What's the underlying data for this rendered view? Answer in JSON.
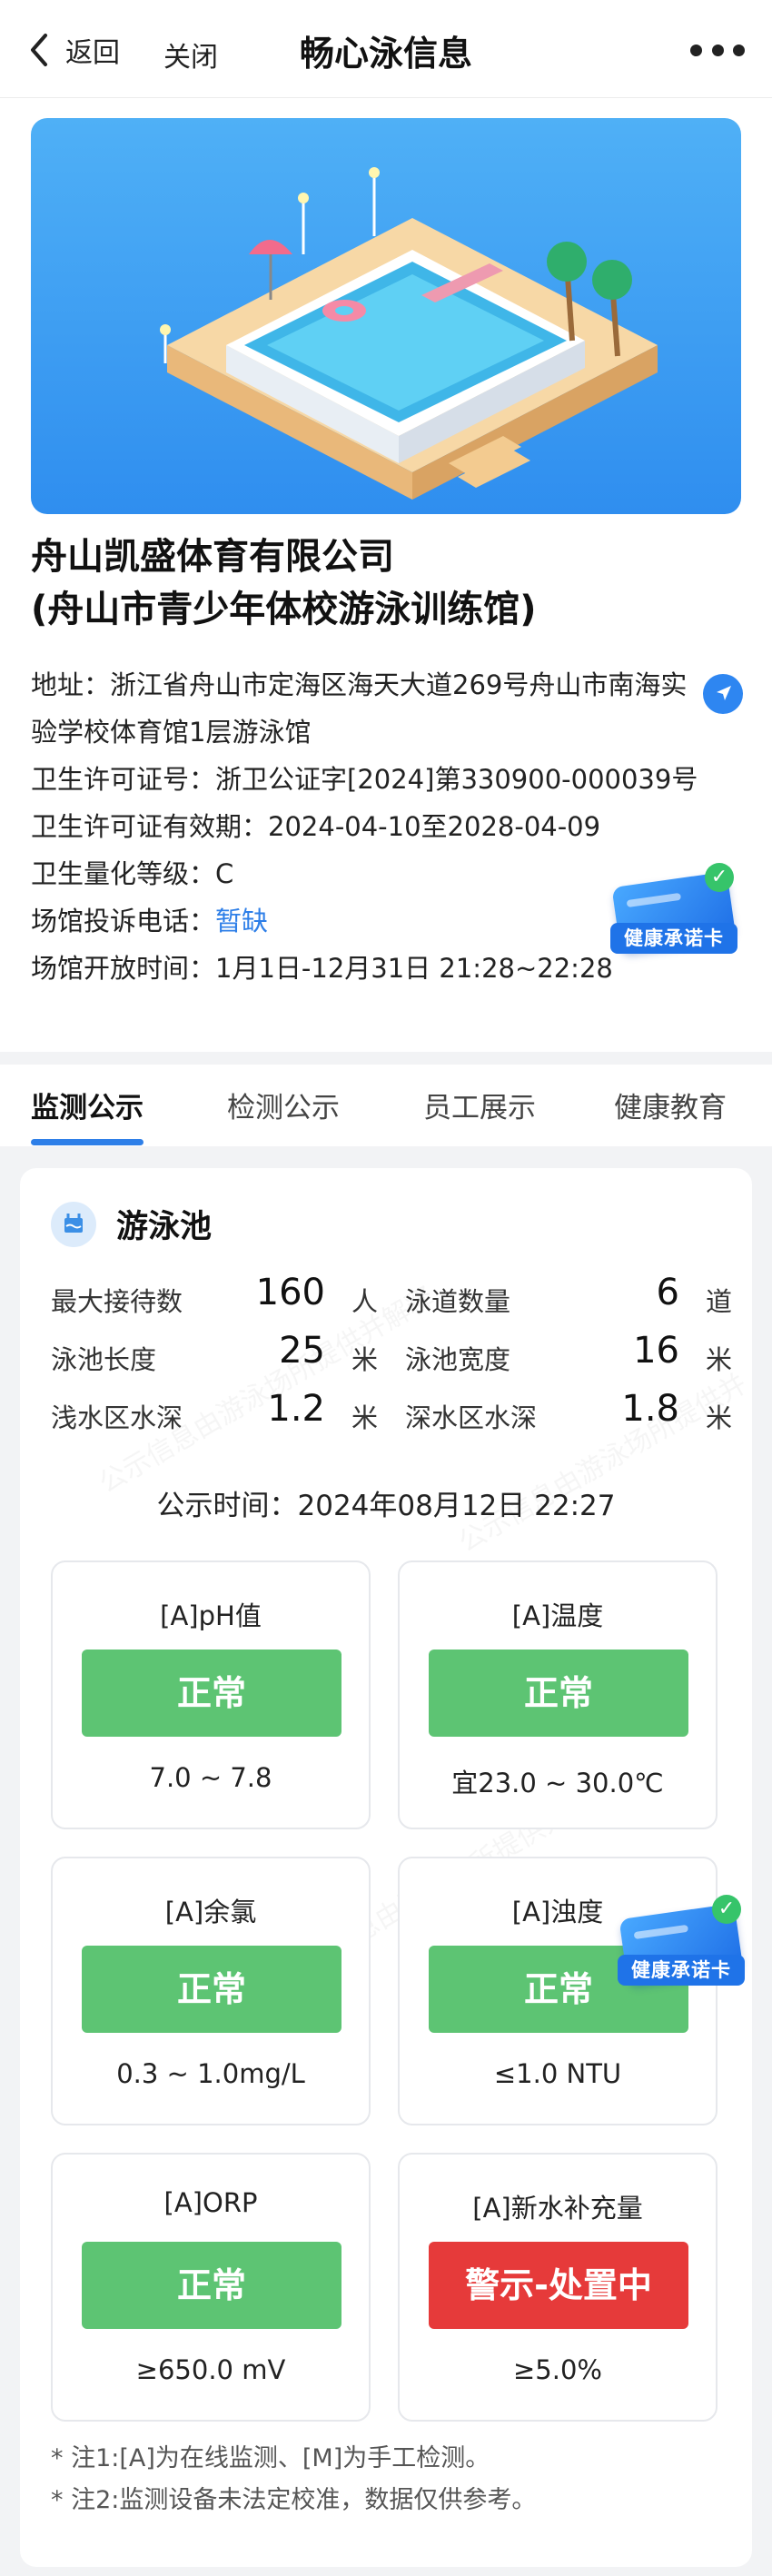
{
  "nav": {
    "back_label": "返回",
    "close_label": "关闭",
    "title": "畅心泳信息"
  },
  "venue": {
    "name_line1": "舟山凯盛体育有限公司",
    "name_line2": "(舟山市青少年体校游泳训练馆)",
    "address_label": "地址：",
    "address_value": "浙江省舟山市定海区海天大道269号舟山市南海实验学校体育馆1层游泳馆",
    "license_label": "卫生许可证号：",
    "license_value": "浙卫公证字[2024]第330900-000039号",
    "validity_label": "卫生许可证有效期：",
    "validity_value": "2024-04-10至2028-04-09",
    "grade_label": "卫生量化等级：",
    "grade_value": "C",
    "phone_label": "场馆投诉电话：",
    "phone_value": "暂缺",
    "hours_label": "场馆开放时间：",
    "hours_value": "1月1日-12月31日    21:28~22:28",
    "health_badge_text": "健康承诺卡"
  },
  "tabs": [
    {
      "label": "监测公示",
      "active": true
    },
    {
      "label": "检测公示",
      "active": false
    },
    {
      "label": "员工展示",
      "active": false
    },
    {
      "label": "健康教育",
      "active": false
    }
  ],
  "pool": {
    "title": "游泳池",
    "stats": [
      {
        "key": "最大接待数",
        "value": "160",
        "unit": "人"
      },
      {
        "key": "泳道数量",
        "value": "6",
        "unit": "道"
      },
      {
        "key": "泳池长度",
        "value": "25",
        "unit": "米"
      },
      {
        "key": "泳池宽度",
        "value": "16",
        "unit": "米"
      },
      {
        "key": "浅水区水深",
        "value": "1.2",
        "unit": "米"
      },
      {
        "key": "深水区水深",
        "value": "1.8",
        "unit": "米"
      }
    ],
    "publish_time": "公示时间：2024年08月12日 22:27",
    "metrics": [
      {
        "name": "[A]pH值",
        "status": "正常",
        "range": "7.0 ~ 7.8",
        "level": "ok"
      },
      {
        "name": "[A]温度",
        "status": "正常",
        "range": "宜23.0 ~ 30.0℃",
        "level": "ok"
      },
      {
        "name": "[A]余氯",
        "status": "正常",
        "range": "0.3 ~ 1.0mg/L",
        "level": "ok"
      },
      {
        "name": "[A]浊度",
        "status": "正常",
        "range": "≤1.0 NTU",
        "level": "ok"
      },
      {
        "name": "[A]ORP",
        "status": "正常",
        "range": "≥650.0 mV",
        "level": "ok"
      },
      {
        "name": "[A]新水补充量",
        "status": "警示-处置中",
        "range": "≥5.0%",
        "level": "warn"
      }
    ],
    "notes": [
      "* 注1:[A]为在线监测、[M]为手工检测。",
      "* 注2:监测设备未法定校准，数据仅供参考。"
    ]
  },
  "colors": {
    "accent": "#2e7fe8",
    "ok": "#5dc473",
    "warn": "#e63a3a"
  }
}
